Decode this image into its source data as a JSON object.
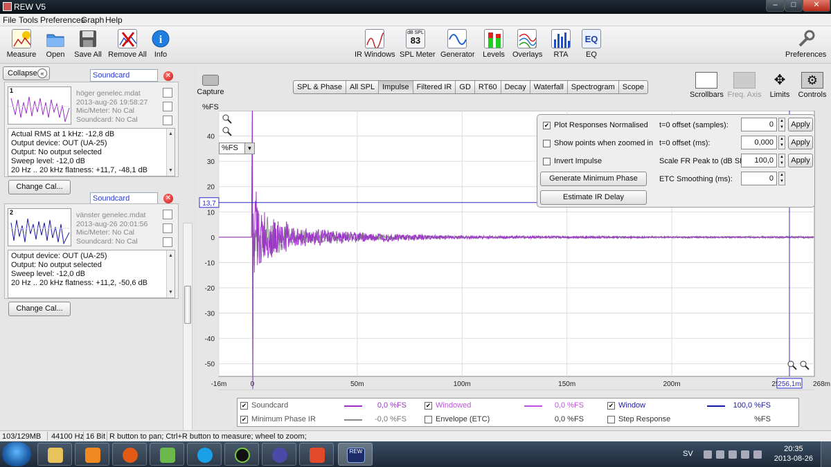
{
  "window": {
    "title": "REW V5"
  },
  "menu": [
    "File",
    "Tools",
    "Preferences",
    "Graph",
    "Help"
  ],
  "toolbar": {
    "left": [
      "Measure",
      "Open",
      "Save All",
      "Remove All",
      "Info"
    ],
    "center": [
      "IR Windows",
      "SPL Meter",
      "Generator",
      "Levels",
      "Overlays",
      "RTA",
      "EQ"
    ],
    "spl_meter_badge": {
      "top": "dB SPL",
      "value": "83"
    },
    "eq_badge": "EQ",
    "right": "Preferences"
  },
  "panel": {
    "collapse_label": "Collapse",
    "measurements": [
      {
        "index": "1",
        "name": "Soundcard",
        "file": "höger genelec.mdat",
        "date": "2013-aug-26 19:58:27",
        "mic": "Mic/Meter: No Cal",
        "soundcard": "Soundcard: No Cal",
        "info": [
          "Actual RMS at 1 kHz: -12,8 dB",
          "Output device: OUT (UA-25)",
          "Output: No output selected",
          "Sweep level: -12,0 dB",
          "20 Hz .. 20 kHz flatness: +11,7, -48,1 dB"
        ],
        "button": "Change Cal..."
      },
      {
        "index": "2",
        "name": "Soundcard",
        "file": "vänster genelec.mdat",
        "date": "2013-aug-26 20:01:56",
        "mic": "Mic/Meter: No Cal",
        "soundcard": "Soundcard: No Cal",
        "info": [
          "Output device: OUT (UA-25)",
          "Output: No output selected",
          "Sweep level: -12,0 dB",
          "20 Hz .. 20 kHz flatness: +11,2, -50,6 dB"
        ],
        "button": "Change Cal..."
      }
    ]
  },
  "graph_toolbar": {
    "capture": "Capture",
    "tabs": [
      "SPL & Phase",
      "All SPL",
      "Impulse",
      "Filtered IR",
      "GD",
      "RT60",
      "Decay",
      "Waterfall",
      "Spectrogram",
      "Scope"
    ],
    "active_tab": "Impulse",
    "right": [
      {
        "label": "Scrollbars",
        "enabled": true
      },
      {
        "label": "Freq. Axis",
        "enabled": false
      },
      {
        "label": "Limits",
        "enabled": true
      },
      {
        "label": "Controls",
        "enabled": true
      }
    ]
  },
  "graph": {
    "y_unit": "%FS",
    "unit_select": "%FS",
    "cursor_y_label": "13,7",
    "cursor_x_label": "256,1m",
    "x_end_label": "268m s",
    "x_near_end_label": "25"
  },
  "chart_data": {
    "type": "line",
    "ylabel": "%FS",
    "xlabel": "s",
    "xlim": [
      -0.016,
      0.268
    ],
    "ylim": [
      -55,
      50
    ],
    "y_ticks": [
      40,
      30,
      20,
      10,
      0,
      -10,
      -20,
      -30,
      -40,
      -50
    ],
    "x_ticks": [
      {
        "value": -0.016,
        "label": "-16m"
      },
      {
        "value": 0,
        "label": "0"
      },
      {
        "value": 0.05,
        "label": "50m"
      },
      {
        "value": 0.1,
        "label": "100m"
      },
      {
        "value": 0.15,
        "label": "150m"
      },
      {
        "value": 0.2,
        "label": "200m"
      }
    ],
    "cursor": {
      "x": 0.2561,
      "y": 13.7
    },
    "grid": true,
    "series": [
      {
        "name": "Soundcard",
        "color": "#9b30c8",
        "peak_time": 0,
        "peak_value": 100,
        "envelope": [
          [
            0.002,
            22
          ],
          [
            0.005,
            12
          ],
          [
            0.01,
            9
          ],
          [
            0.02,
            5
          ],
          [
            0.04,
            3
          ],
          [
            0.06,
            2
          ],
          [
            0.1,
            0.8
          ],
          [
            0.2,
            0.3
          ]
        ]
      },
      {
        "name": "Minimum Phase IR",
        "color": "#888888",
        "peak_time": 0,
        "peak_value": 100,
        "envelope": [
          [
            0.002,
            14
          ],
          [
            0.01,
            8
          ],
          [
            0.02,
            4
          ],
          [
            0.04,
            2.5
          ],
          [
            0.06,
            1.5
          ],
          [
            0.1,
            0.5
          ]
        ]
      }
    ]
  },
  "controls": {
    "checkboxes": [
      {
        "label": "Plot Responses Normalised",
        "checked": true
      },
      {
        "label": "Show points when zoomed in",
        "checked": false
      },
      {
        "label": "Invert Impulse",
        "checked": false
      }
    ],
    "buttons": [
      "Generate Minimum Phase",
      "Estimate IR Delay"
    ],
    "fields": [
      {
        "label": "t=0 offset (samples):",
        "value": "0",
        "apply": "Apply"
      },
      {
        "label": "t=0 offset (ms):",
        "value": "0,000",
        "apply": "Apply"
      },
      {
        "label": "Scale FR Peak to (dB SPL):",
        "value": "100,0",
        "apply": "Apply"
      },
      {
        "label": "ETC Smoothing (ms):",
        "value": "0",
        "apply": ""
      }
    ]
  },
  "legend": [
    {
      "label": "Soundcard",
      "checked": true,
      "color": "#9b30c8",
      "value": "0,0 %FS"
    },
    {
      "label": "Windowed",
      "checked": true,
      "color": "#c050e0",
      "value": "0,0 %FS"
    },
    {
      "label": "Window",
      "checked": true,
      "color": "#1a1aa8",
      "value": "100,0 %FS"
    },
    {
      "label": "Minimum Phase IR",
      "checked": true,
      "color": "#888888",
      "value": "-0,0 %FS"
    },
    {
      "label": "Envelope (ETC)",
      "checked": false,
      "color": "",
      "value": "0,0 %FS"
    },
    {
      "label": "Step Response",
      "checked": false,
      "color": "",
      "value": "%FS"
    }
  ],
  "status": {
    "memory": "103/129MB",
    "rate": "44100 Hz",
    "bits": "16 Bit",
    "hint": "R button to pan; Ctrl+R button to measure; wheel to zoom;"
  },
  "taskbar": {
    "lang": "SV",
    "time": "20:35",
    "date": "2013-08-26",
    "rew_label": "REW"
  },
  "colors": {
    "series_purple": "#9b30c8",
    "series_gray": "#888888",
    "window_blue": "#1a1aa8",
    "cursor_blue": "#2b2bd0"
  }
}
